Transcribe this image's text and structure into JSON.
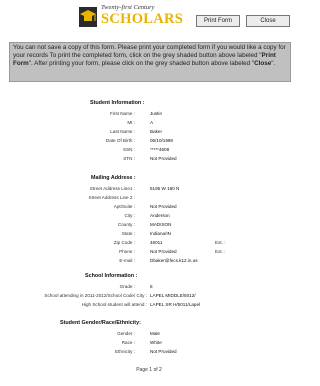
{
  "header": {
    "logo_top": "Twenty-first Century",
    "logo_name": "SCHOLARS",
    "print_label": "Print Form",
    "close_label": "Close"
  },
  "notice": {
    "text1": "You can not save a copy of this form.  Please print your completed form if you would like a copy for your records  To print the completed form, click on the grey shaded button above labeled \"",
    "print_bold": "Print Form",
    "text2": "\".  After printing your form, please click on the grey shaded button above labeled \"",
    "close_bold": "Close",
    "text3": "\"."
  },
  "student_info": {
    "heading": "Student Information :",
    "first_name_label": "First Name :",
    "first_name": "Justin",
    "mi_label": "MI :",
    "mi": "A",
    "last_name_label": "Last Name :",
    "last_name": "Baker",
    "dob_label": "Date Of Birth :",
    "dob": "06/10/1998",
    "ssn_label": "SSN :",
    "ssn": "*****4608",
    "stn_label": "STN :",
    "stn": "Not Provided"
  },
  "mailing": {
    "heading": "Mailing Address :",
    "street1_label": "Street Address Line1 :",
    "street1": "6195 W 180 N",
    "street2_label": "Street Address Line 2 :",
    "street2": "",
    "apt_label": "Apt/Suite :",
    "apt": "Not Provided",
    "city_label": "City :",
    "city": "Anderson",
    "county_label": "County :",
    "county": "MADISON",
    "state_label": "State :",
    "state": "Indiana/IN",
    "zip_label": "Zip Code :",
    "zip": "46011",
    "phone_label": "Phone :",
    "phone": "Not Provided",
    "email_label": "E-mail :",
    "email": "Dbaker@fecs.k12.in.us",
    "ext_label1": "Ext. :",
    "ext_label2": "Ext. :"
  },
  "school": {
    "heading": "School Information :",
    "grade_label": "Grade :",
    "grade": "8",
    "school_attending_label": "School attending in 2011-2012/School Code/ City :",
    "school_attending": "LAPEL MIDDLE/5012/",
    "high_school_label": "High School student will attend :",
    "high_school": "LAPEL SR H/5011/Lapel"
  },
  "gender_race": {
    "heading": "Student Gender/Race/Ethnicity:",
    "gender_label": "Gender :",
    "gender": "Male",
    "race_label": "Race :",
    "race": "White",
    "ethnicity_label": "Ethnicity :",
    "ethnicity": "Not Provided"
  },
  "footer": {
    "page": "Page 1 of 2"
  }
}
